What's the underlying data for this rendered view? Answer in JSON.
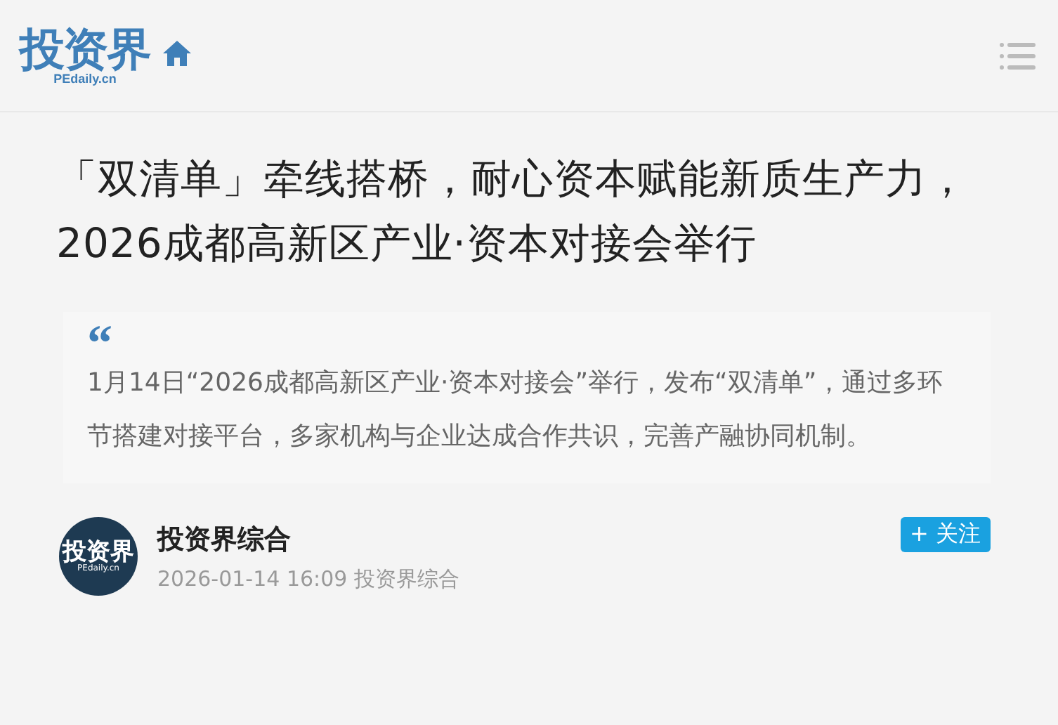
{
  "header": {
    "logo": {
      "name": "投资界",
      "domain": "PEdaily.cn"
    }
  },
  "article": {
    "title": "「双清单」牵线搭桥，耐心资本赋能新质生产力，2026成都高新区产业·资本对接会举行",
    "quote_mark": "“",
    "summary": "1月14日“2026成都高新区产业·资本对接会”举行，发布“双清单”，通过多环节搭建对接平台，多家机构与企业达成合作共识，完善产融协同机制。"
  },
  "author": {
    "avatar": {
      "name": "投资界",
      "domain": "PEdaily.cn"
    },
    "name": "投资界综合",
    "meta": "2026-01-14 16:09 投资界综合",
    "follow": "+ 关注"
  }
}
